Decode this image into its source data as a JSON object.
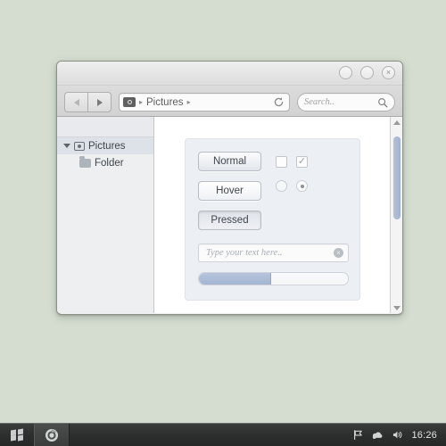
{
  "desktop": {
    "background_color": "#d5ddd1"
  },
  "window": {
    "titlebar": {
      "buttons": [
        {
          "name": "minimize",
          "glyph": ""
        },
        {
          "name": "maximize",
          "glyph": ""
        },
        {
          "name": "close",
          "glyph": "×"
        }
      ]
    },
    "toolbar": {
      "back_label": "Back",
      "forward_label": "Forward",
      "breadcrumb": {
        "icon": "camera-icon",
        "separator": "▸",
        "path": "Pictures",
        "trailing_separator": "▸",
        "refresh_label": "Refresh"
      },
      "search": {
        "placeholder": "Search..",
        "value": "",
        "icon": "search-icon"
      }
    },
    "sidebar": {
      "items": [
        {
          "label": "Pictures",
          "icon": "camera-icon",
          "selected": true,
          "expanded": true
        },
        {
          "label": "Folder",
          "icon": "folder-icon",
          "selected": false,
          "child": true
        }
      ]
    },
    "content": {
      "panel": {
        "buttons": [
          {
            "label": "Normal",
            "state": "normal"
          },
          {
            "label": "Hover",
            "state": "hover"
          },
          {
            "label": "Pressed",
            "state": "pressed"
          }
        ],
        "checkboxes": [
          {
            "name": "checkbox-unchecked",
            "checked": false,
            "glyph": ""
          },
          {
            "name": "checkbox-checked",
            "checked": true,
            "glyph": "✓"
          }
        ],
        "radios": [
          {
            "name": "radio-unselected",
            "selected": false
          },
          {
            "name": "radio-selected",
            "selected": true
          }
        ],
        "textfield": {
          "placeholder": "Type your text here..",
          "value": "",
          "clear_glyph": "×"
        },
        "progress": {
          "percent": 48,
          "fill_color": "#a9bcd8"
        }
      },
      "scrollbar": {
        "up_label": "Scroll up",
        "down_label": "Scroll down",
        "thumb_label": "Scroll thumb"
      }
    }
  },
  "taskbar": {
    "start_label": "Start",
    "tasks": [
      {
        "name": "browser",
        "active": true
      }
    ],
    "tray": [
      {
        "name": "flag-icon"
      },
      {
        "name": "network-icon"
      },
      {
        "name": "volume-icon"
      }
    ],
    "clock": "16:26"
  }
}
